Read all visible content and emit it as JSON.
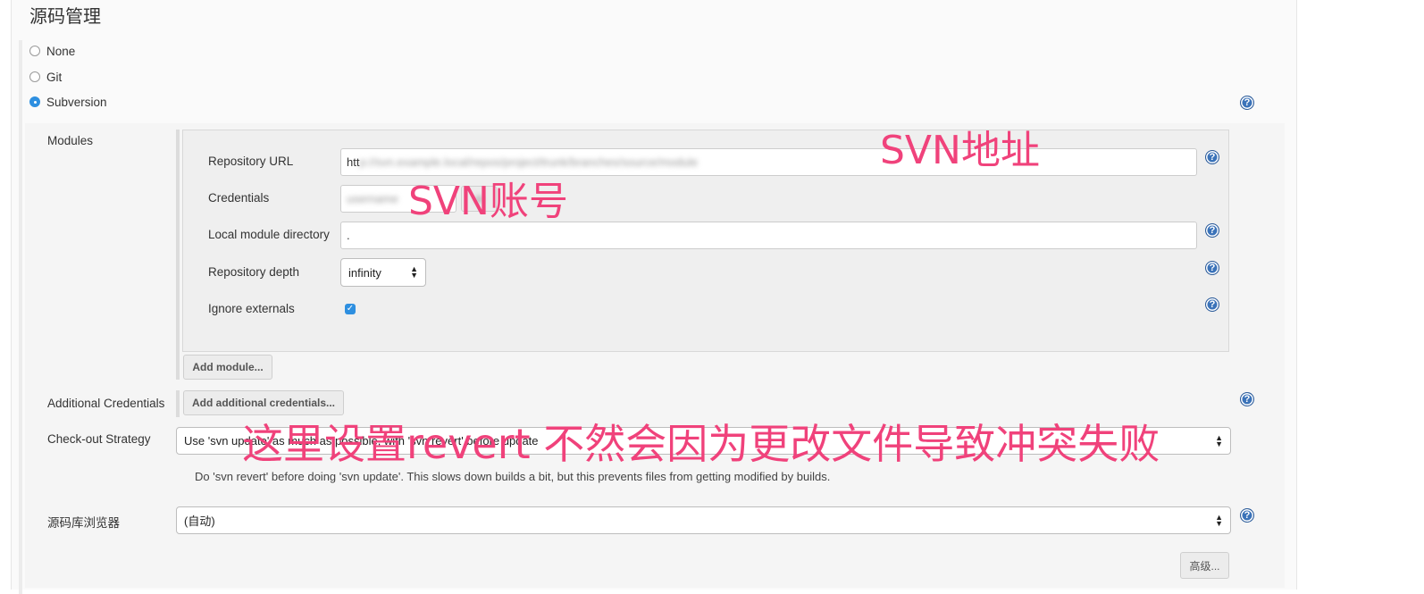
{
  "section": {
    "title": "源码管理"
  },
  "scm_options": [
    {
      "label": "None",
      "checked": false
    },
    {
      "label": "Git",
      "checked": false
    },
    {
      "label": "Subversion",
      "checked": true
    }
  ],
  "modules": {
    "label": "Modules",
    "repository_url": {
      "label": "Repository URL",
      "value_prefix": "htt",
      "value_blurred": "p://svn.example.local/repos/project/trunk/branches/source/module"
    },
    "credentials": {
      "label": "Credentials",
      "value_blurred": "username"
    },
    "local_module_directory": {
      "label": "Local module directory",
      "value": "."
    },
    "repository_depth": {
      "label": "Repository depth",
      "value": "infinity"
    },
    "ignore_externals": {
      "label": "Ignore externals",
      "checked": true
    },
    "add_module_button": "Add module..."
  },
  "additional_credentials": {
    "label": "Additional Credentials",
    "button": "Add additional credentials..."
  },
  "checkout_strategy": {
    "label": "Check-out Strategy",
    "value": "Use 'svn update' as much as possible, with 'svn revert' before update",
    "description": "Do 'svn revert' before doing 'svn update'. This slows down builds a bit, but this prevents files from getting modified by builds."
  },
  "repo_browser": {
    "label": "源码库浏览器",
    "value": "(自动)"
  },
  "advanced_button": "高级...",
  "annotations": {
    "svn_address": "SVN地址",
    "svn_account": "SVN账号",
    "revert_note": "这里设置revert 不然会因为更改文件导致冲突失败"
  },
  "icons": {
    "help": "help-icon",
    "dropdown": "dropdown-arrows-icon",
    "check": "checkbox-check-icon"
  },
  "colors": {
    "annotation": "#f0427b",
    "accent": "#2e8fe0",
    "help": "#3b73b9"
  }
}
